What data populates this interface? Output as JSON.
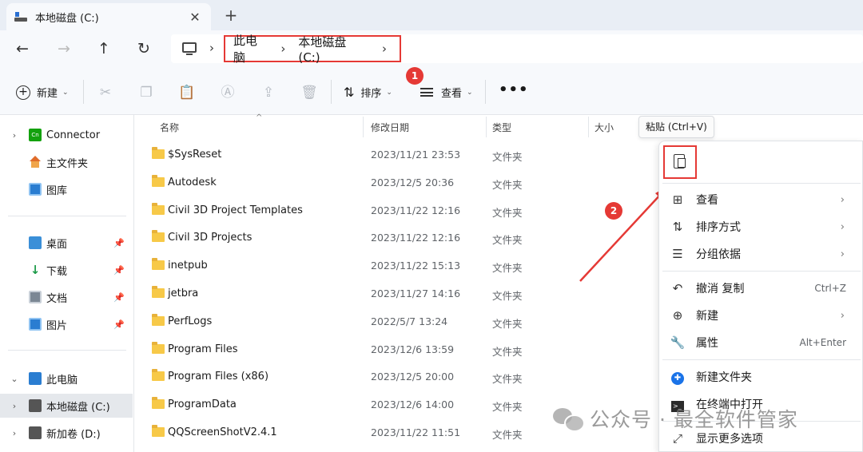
{
  "tab": {
    "title": "本地磁盘 (C:)",
    "close": "✕",
    "new_tab": "+"
  },
  "nav": {
    "back": "←",
    "forward": "→",
    "up": "↑",
    "refresh": "↻",
    "separator": "›"
  },
  "breadcrumb": [
    "此电脑",
    "本地磁盘 (C:)"
  ],
  "toolbar": {
    "new_label": "新建",
    "sort_label": "排序",
    "view_label": "查看",
    "more": "•••"
  },
  "annotations": {
    "badge1": "1",
    "badge2": "2"
  },
  "sidebar": {
    "items": [
      {
        "label": "Connector",
        "icon": "connector-icon",
        "expand": "›"
      },
      {
        "label": "主文件夹",
        "icon": "home-icon"
      },
      {
        "label": "图库",
        "icon": "gallery-icon"
      },
      {
        "label": "桌面",
        "icon": "desktop-icon",
        "pinned": true
      },
      {
        "label": "下载",
        "icon": "download-icon",
        "pinned": true
      },
      {
        "label": "文档",
        "icon": "document-icon",
        "pinned": true
      },
      {
        "label": "图片",
        "icon": "pictures-icon",
        "pinned": true
      },
      {
        "label": "此电脑",
        "icon": "this-pc-icon",
        "expand": "⌄"
      },
      {
        "label": "本地磁盘 (C:)",
        "icon": "drive-icon",
        "expand": "›",
        "selected": true
      },
      {
        "label": "新加卷 (D:)",
        "icon": "drive-icon",
        "expand": "›"
      }
    ]
  },
  "columns": {
    "name": "名称",
    "modified": "修改日期",
    "type": "类型",
    "size": "大小"
  },
  "files": [
    {
      "name": "$SysReset",
      "date": "2023/11/21 23:53",
      "type": "文件夹"
    },
    {
      "name": "Autodesk",
      "date": "2023/12/5 20:36",
      "type": "文件夹"
    },
    {
      "name": "Civil 3D Project Templates",
      "date": "2023/11/22 12:16",
      "type": "文件夹"
    },
    {
      "name": "Civil 3D Projects",
      "date": "2023/11/22 12:16",
      "type": "文件夹"
    },
    {
      "name": "inetpub",
      "date": "2023/11/22 15:13",
      "type": "文件夹"
    },
    {
      "name": "jetbra",
      "date": "2023/11/27 14:16",
      "type": "文件夹"
    },
    {
      "name": "PerfLogs",
      "date": "2022/5/7 13:24",
      "type": "文件夹"
    },
    {
      "name": "Program Files",
      "date": "2023/12/6 13:59",
      "type": "文件夹"
    },
    {
      "name": "Program Files (x86)",
      "date": "2023/12/5 20:00",
      "type": "文件夹"
    },
    {
      "name": "ProgramData",
      "date": "2023/12/6 14:00",
      "type": "文件夹"
    },
    {
      "name": "QQScreenShotV2.4.1",
      "date": "2023/11/22 11:51",
      "type": "文件夹"
    }
  ],
  "tooltip": "粘贴 (Ctrl+V)",
  "context_menu": {
    "items": [
      {
        "label": "查看",
        "icon": "grid-icon",
        "submenu": true
      },
      {
        "label": "排序方式",
        "icon": "sort-icon",
        "submenu": true
      },
      {
        "label": "分组依据",
        "icon": "group-icon",
        "submenu": true
      },
      {
        "label": "撤消 复制",
        "icon": "undo-icon",
        "shortcut": "Ctrl+Z"
      },
      {
        "label": "新建",
        "icon": "new-icon",
        "submenu": true
      },
      {
        "label": "属性",
        "icon": "properties-icon",
        "shortcut": "Alt+Enter"
      },
      {
        "label": "新建文件夹",
        "icon": "new-folder-icon"
      },
      {
        "label": "在终端中打开",
        "icon": "terminal-icon"
      },
      {
        "label": "显示更多选项",
        "icon": "more-options-icon"
      }
    ]
  },
  "watermark": "公众号 · 最全软件管家",
  "colors": {
    "accent_red": "#e53935",
    "folder": "#f7c948",
    "selected_bg": "#e5e8ec"
  }
}
